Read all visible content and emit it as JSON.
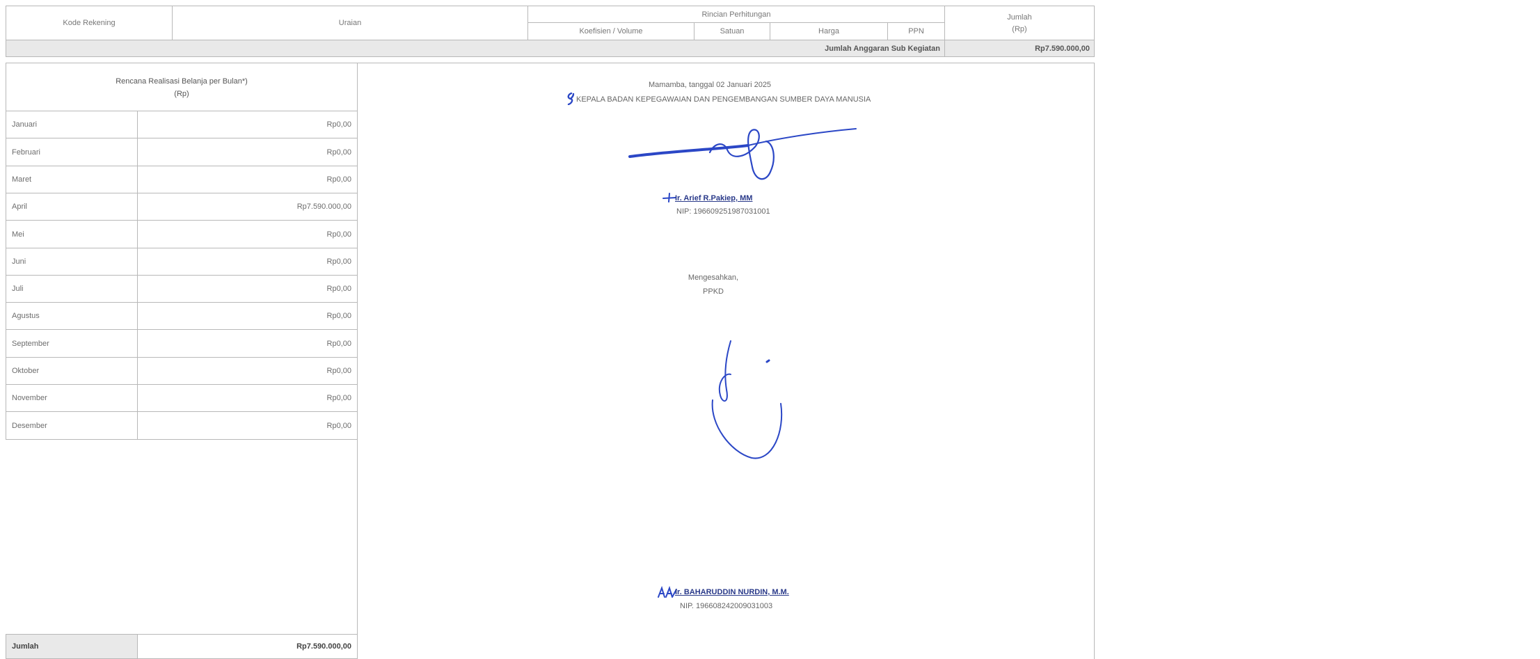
{
  "header": {
    "kode_rekening": "Kode Rekening",
    "uraian": "Uraian",
    "rincian": "Rincian Perhitungan",
    "koefisien": "Koefisien / Volume",
    "satuan": "Satuan",
    "harga": "Harga",
    "ppn": "PPN",
    "jumlah": "Jumlah",
    "jumlah_unit": "(Rp)"
  },
  "summary": {
    "label": "Jumlah Anggaran Sub Kegiatan",
    "value": "Rp7.590.000,00"
  },
  "rencana": {
    "title": "Rencana Realisasi Belanja per Bulan*)",
    "unit": "(Rp)",
    "months": [
      {
        "label": "Januari",
        "value": "Rp0,00"
      },
      {
        "label": "Februari",
        "value": "Rp0,00"
      },
      {
        "label": "Maret",
        "value": "Rp0,00"
      },
      {
        "label": "April",
        "value": "Rp7.590.000,00"
      },
      {
        "label": "Mei",
        "value": "Rp0,00"
      },
      {
        "label": "Juni",
        "value": "Rp0,00"
      },
      {
        "label": "Juli",
        "value": "Rp0,00"
      },
      {
        "label": "Agustus",
        "value": "Rp0,00"
      },
      {
        "label": "September",
        "value": "Rp0,00"
      },
      {
        "label": "Oktober",
        "value": "Rp0,00"
      },
      {
        "label": "November",
        "value": "Rp0,00"
      },
      {
        "label": "Desember",
        "value": "Rp0,00"
      }
    ],
    "total_label": "Jumlah",
    "total_value": "Rp7.590.000,00"
  },
  "signature": {
    "place_date": "Mamamba, tanggal 02 Januari 2025",
    "position": "KEPALA BADAN KEPEGAWAIAN DAN PENGEMBANGAN SUMBER DAYA MANUSIA",
    "name1": "Ir. Arief R.Pakiep, MM",
    "nip1": "NIP: 196609251987031001",
    "mengesahkan": "Mengesahkan,",
    "ppkd": "PPKD",
    "name2": "Ir. BAHARUDDIN NURDIN, M.M.",
    "nip2": "NIP. 196608242009031003"
  },
  "colors": {
    "border": "#b8b8b8",
    "summary_bg": "#e9e9e9",
    "ink": "#2b47c6"
  }
}
